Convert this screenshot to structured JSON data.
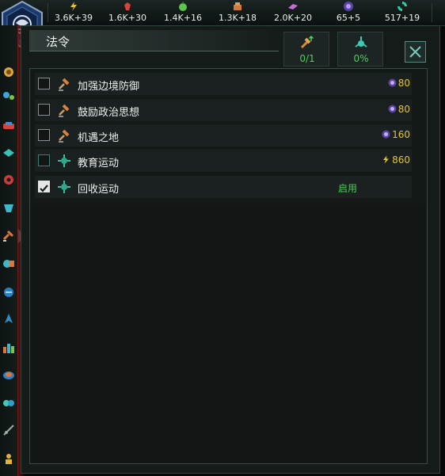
{
  "resources": [
    {
      "icon": "energy-icon",
      "value": "3.6K+39",
      "color": "#e6c22f"
    },
    {
      "icon": "minerals-icon",
      "value": "1.6K+30",
      "color": "#d9413c"
    },
    {
      "icon": "food-icon",
      "value": "1.4K+16",
      "color": "#5bc44b"
    },
    {
      "icon": "consumer-goods-icon",
      "value": "1.3K+18",
      "color": "#d07a3c"
    },
    {
      "icon": "alloys-icon",
      "value": "2.0K+20",
      "color": "#c36fd6"
    },
    {
      "icon": "influence-icon",
      "value": "65+5",
      "color": "#9b7be0"
    },
    {
      "icon": "unity-icon",
      "value": "517+19",
      "color": "#39c7a5"
    }
  ],
  "panel": {
    "title": "法令",
    "stats": [
      {
        "icon": "edict-capacity-icon",
        "value": "0/1"
      },
      {
        "icon": "edict-fund-icon",
        "value": "0%"
      }
    ]
  },
  "edicts": [
    {
      "name": "加强边境防御",
      "icon": "gavel-icon",
      "cost": "80",
      "cost_icon": "influence-icon",
      "checked": false,
      "status": ""
    },
    {
      "name": "鼓励政治思想",
      "icon": "gavel-icon",
      "cost": "80",
      "cost_icon": "influence-icon",
      "checked": false,
      "status": ""
    },
    {
      "name": "机遇之地",
      "icon": "gavel-icon",
      "cost": "160",
      "cost_icon": "influence-icon",
      "checked": false,
      "status": ""
    },
    {
      "name": "教育运动",
      "icon": "campaign-icon",
      "cost": "860",
      "cost_icon": "energy-icon",
      "checked": false,
      "status": ""
    },
    {
      "name": "回收运动",
      "icon": "campaign-icon",
      "cost": "",
      "cost_icon": "",
      "checked": true,
      "status": "启用"
    }
  ],
  "sidebar_icons": [
    "empire-icon",
    "government-icon",
    "planets-icon",
    "contacts-icon",
    "situation-icon",
    "policies-icon",
    "edicts-icon",
    "traditions-icon",
    "technology-icon",
    "fleets-icon",
    "expansion-icon",
    "species-icon",
    "leaders-icon",
    "genetics-icon",
    "relics-icon"
  ]
}
